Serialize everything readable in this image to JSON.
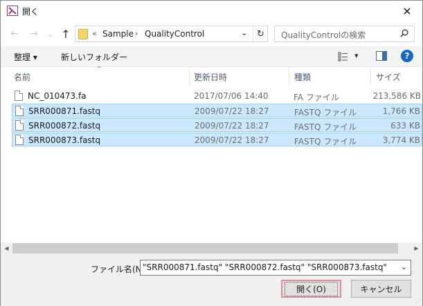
{
  "window": {
    "title": "開く",
    "close_label": "✕"
  },
  "nav": {
    "back": "←",
    "forward": "→",
    "recent": "⌄",
    "up": "↑",
    "crumb_prefix": "«",
    "crumbs": [
      "Sample",
      "QualityControl"
    ],
    "separator": "›",
    "address_dropdown": "⌄",
    "refresh": "↻"
  },
  "search": {
    "placeholder": "QualityControlの検索"
  },
  "toolbar": {
    "organize_label": "整理 ▾",
    "new_folder_label": "新しいフォルダー",
    "view_dropdown": "▾",
    "help_label": "?"
  },
  "columns": {
    "name": "名前",
    "modified": "更新日時",
    "type": "種類",
    "size": "サイズ",
    "sort_indicator": "^"
  },
  "files": [
    {
      "name": "NC_010473.fa",
      "modified": "2017/07/06 14:40",
      "type": "FA ファイル",
      "size": "213,586 KB",
      "selected": false
    },
    {
      "name": "SRR000871.fastq",
      "modified": "2009/07/22 18:27",
      "type": "FASTQ ファイル",
      "size": "1,766 KB",
      "selected": true
    },
    {
      "name": "SRR000872.fastq",
      "modified": "2009/07/22 18:27",
      "type": "FASTQ ファイル",
      "size": "633 KB",
      "selected": true
    },
    {
      "name": "SRR000873.fastq",
      "modified": "2009/07/22 18:27",
      "type": "FASTQ ファイル",
      "size": "3,774 KB",
      "selected": true
    }
  ],
  "scrollbar": {
    "left_arrow": "◀",
    "right_arrow": "▶"
  },
  "footer": {
    "filename_label": "ファイル名(N):",
    "filename_value": "\"SRR000871.fastq\" \"SRR000872.fastq\" \"SRR000873.fastq\"",
    "filename_dropdown": "⌄",
    "open_label": "開く(O)",
    "cancel_label": "キャンセル"
  },
  "colors": {
    "selection_bg": "#cce8ff",
    "selection_border": "#99d1ff",
    "help_blue": "#1667c6",
    "header_text": "#4c607a",
    "open_focus_border": "#e88c9a"
  }
}
